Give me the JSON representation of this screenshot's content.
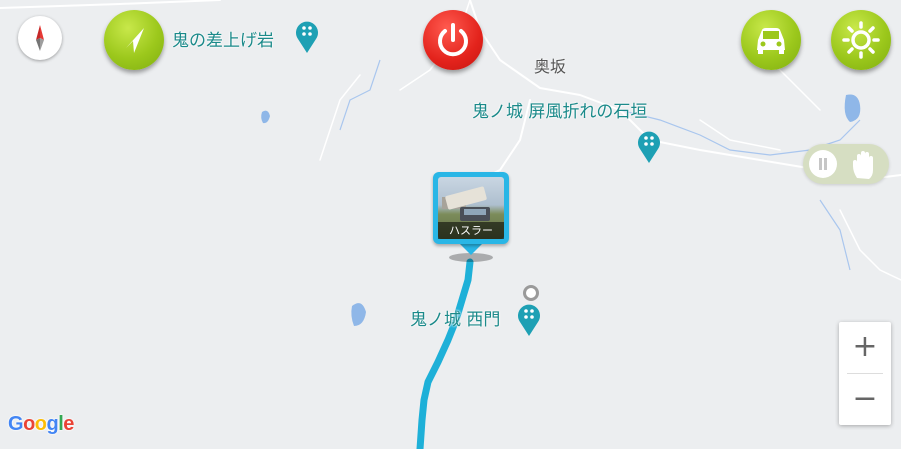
{
  "map": {
    "labels": {
      "poi_oni_sashiage": "鬼の差上げ岩",
      "poi_byobu": "鬼ノ城 屏風折れの石垣",
      "poi_nishimon": "鬼ノ城 西門",
      "town_okusaka": "奥坂"
    },
    "vehicle": {
      "name": "ハスラー"
    },
    "route_color": "#1eb0d8",
    "water_color": "#8fb7e8",
    "road_color": "#ffffff",
    "background_color": "#eceef0",
    "attribution": "Google"
  },
  "controls": {
    "compass_icon": "compass-icon",
    "navigate_icon": "navigation-arrow-icon",
    "power_icon": "power-icon",
    "car_icon": "car-icon",
    "brightness_icon": "sun-icon",
    "zoom_in": "+",
    "zoom_out": "−",
    "pause_icon": "pause-icon",
    "hand_icon": "hand-icon",
    "green_color": "#9cc81c",
    "red_color": "#e3231c"
  }
}
